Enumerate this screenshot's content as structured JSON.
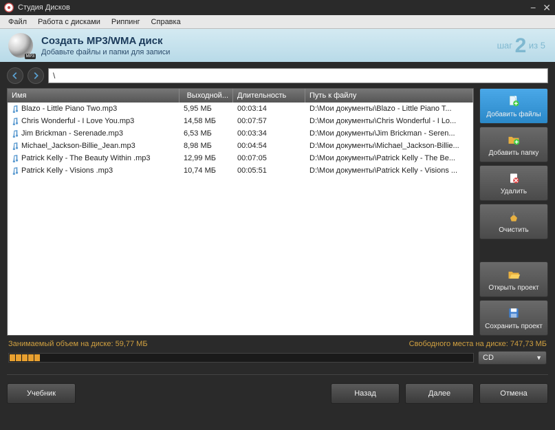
{
  "window": {
    "title": "Студия Дисков"
  },
  "menu": {
    "file": "Файл",
    "discs": "Работа с дисками",
    "ripping": "Риппинг",
    "help": "Справка"
  },
  "header": {
    "title": "Создать MP3/WMA диск",
    "subtitle": "Добавьте файлы и папки для записи",
    "step_prefix": "шаг",
    "step_num": "2",
    "step_of": "из 5",
    "disc_badge": "MP3"
  },
  "nav": {
    "path": "\\"
  },
  "columns": {
    "name": "Имя",
    "size": "Выходной...",
    "duration": "Длительность",
    "path": "Путь к файлу"
  },
  "files": [
    {
      "name": "Blazo - Little Piano Two.mp3",
      "size": "5,95 МБ",
      "duration": "00:03:14",
      "path": "D:\\Мои документы\\Blazo - Little Piano T..."
    },
    {
      "name": "Chris Wonderful - I Love You.mp3",
      "size": "14,58 МБ",
      "duration": "00:07:57",
      "path": "D:\\Мои документы\\Chris Wonderful - I Lo..."
    },
    {
      "name": "Jim Brickman - Serenade.mp3",
      "size": "6,53 МБ",
      "duration": "00:03:34",
      "path": "D:\\Мои документы\\Jim Brickman - Seren..."
    },
    {
      "name": "Michael_Jackson-Billie_Jean.mp3",
      "size": "8,98 МБ",
      "duration": "00:04:54",
      "path": "D:\\Мои документы\\Michael_Jackson-Billie..."
    },
    {
      "name": "Patrick Kelly - The Beauty Within .mp3",
      "size": "12,99 МБ",
      "duration": "00:07:05",
      "path": "D:\\Мои документы\\Patrick Kelly - The Be..."
    },
    {
      "name": "Patrick Kelly - Visions .mp3",
      "size": "10,74 МБ",
      "duration": "00:05:51",
      "path": "D:\\Мои документы\\Patrick Kelly - Visions ..."
    }
  ],
  "side": {
    "add_files": "Добавить файлы",
    "add_folder": "Добавить папку",
    "delete": "Удалить",
    "clear": "Очистить",
    "open_project": "Открыть проект",
    "save_project": "Сохранить проект"
  },
  "status": {
    "used": "Занимаемый объем на диске: 59,77 МБ",
    "free": "Свободного места на диске: 747,73 МБ"
  },
  "disc_type": "CD",
  "bottom": {
    "tutorial": "Учебник",
    "back": "Назад",
    "next": "Далее",
    "cancel": "Отмена"
  }
}
